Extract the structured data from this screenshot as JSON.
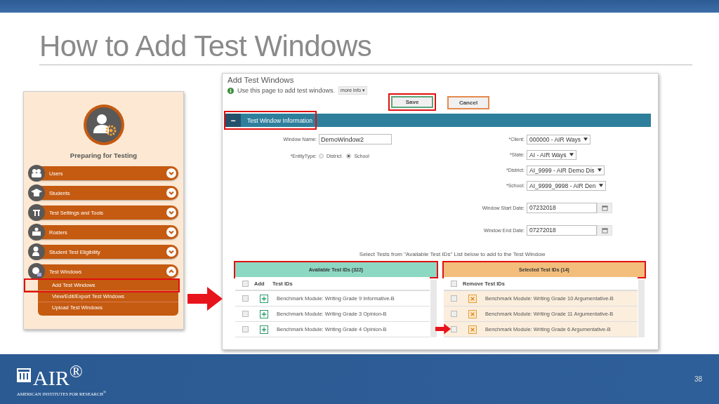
{
  "slide": {
    "title": "How to Add Test Windows",
    "page_number": "38"
  },
  "logo": {
    "name": "AIR$^{®}$",
    "tagline": "AMERICAN INSTITUTES FOR RESEARCH$^{®}$"
  },
  "sidebar": {
    "heading": "Preparing for Testing",
    "items": [
      {
        "label": "Users",
        "expanded": false
      },
      {
        "label": "Students",
        "expanded": false
      },
      {
        "label": "Test Settings and Tools",
        "expanded": false
      },
      {
        "label": "Rosters",
        "expanded": false
      },
      {
        "label": "Student Test Eligibility",
        "expanded": false
      },
      {
        "label": "Test Windows",
        "expanded": true,
        "children": [
          {
            "label": "Add Test Windows",
            "highlighted": true
          },
          {
            "label": "View/Edit/Export Test Windows",
            "highlighted": false
          },
          {
            "label": "Upload Test Windows",
            "highlighted": false
          }
        ]
      }
    ]
  },
  "app": {
    "title": "Add Test Windows",
    "info": "Use this page to add test windows.",
    "more_info": "more info ▾",
    "buttons": [
      {
        "label": "Save",
        "kind": "save",
        "highlighted": true
      },
      {
        "label": "Cancel",
        "kind": "cancel",
        "highlighted": false
      }
    ],
    "section": {
      "label": "Test Window Information",
      "toggle": "−",
      "highlighted": true
    },
    "window_name": {
      "label": "Window Name:",
      "value": "DemoWindow2"
    },
    "entity_type": {
      "label": "*EntityType:",
      "options": [
        {
          "label": "District",
          "selected": false
        },
        {
          "label": "School",
          "selected": true
        }
      ]
    },
    "selects": [
      {
        "label": "*Client:",
        "value": "000000 - AIR Ways"
      },
      {
        "label": "*State:",
        "value": "AI - AIR Ways"
      },
      {
        "label": "*District:",
        "value": "AI_9999 - AIR Demo Dis"
      },
      {
        "label": "*School:",
        "value": "AI_9999_9998 - AIR Den"
      }
    ],
    "dates": [
      {
        "label": "Window Start Date:",
        "value": "07232018"
      },
      {
        "label": "Window End Date:",
        "value": "07272018"
      }
    ],
    "instruction": "Select Tests from \"Available Test IDs\" List below to add to the Test Window",
    "available": {
      "header": "Available Test IDs (322)",
      "highlighted": true,
      "add_column": "Add",
      "id_column": "Test IDs",
      "checked": false,
      "rows": [
        {
          "label": "Benchmark Module: Writing Grade 9 Informative-B",
          "checked": false,
          "arrow": true
        },
        {
          "label": "Benchmark Module: Writing Grade 3 Opinion-B",
          "checked": false,
          "arrow": false
        },
        {
          "label": "Benchmark Module: Writing Grade 4 Opinion-B",
          "checked": false,
          "arrow": false
        }
      ]
    },
    "selected": {
      "header": "Selected Test IDs (14)",
      "highlighted": true,
      "id_column": "Remove Test IDs",
      "checked": false,
      "rows": [
        {
          "label": "Benchmark Module: Writing Grade 10 Argumentative-B",
          "checked": false,
          "arrow": false
        },
        {
          "label": "Benchmark Module: Writing Grade 11 Argumentative-B",
          "checked": false,
          "arrow": false
        },
        {
          "label": "Benchmark Module: Writing Grade 6 Argumentative-B",
          "checked": false,
          "arrow": true
        }
      ]
    }
  }
}
